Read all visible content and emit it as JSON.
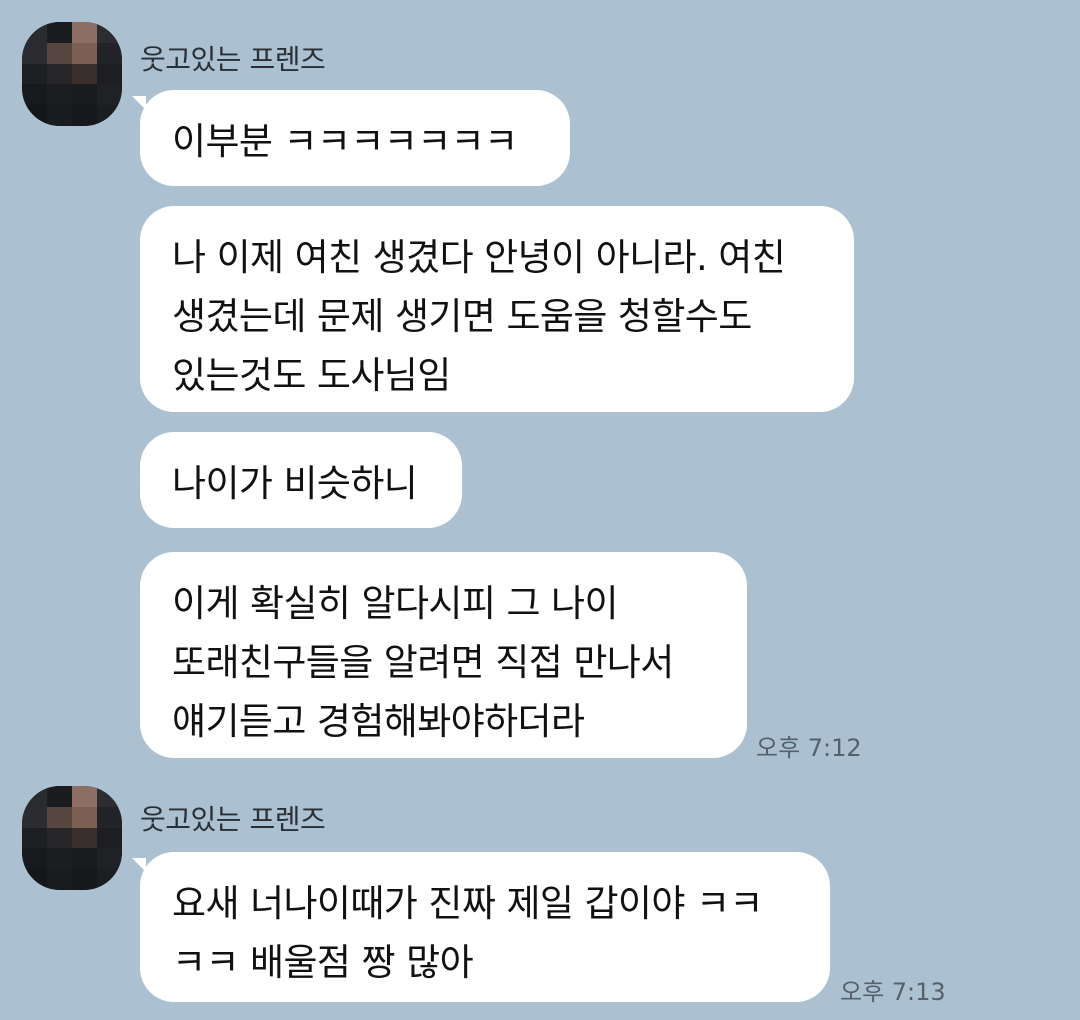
{
  "colors": {
    "chat_background": "#abc1d1",
    "bubble": "#ffffff",
    "text": "#111111"
  },
  "groups": [
    {
      "sender": "웃고있는 프렌즈",
      "avatar_icon": "pixelated-profile-photo",
      "messages": [
        {
          "text": "이부분 ㅋㅋㅋㅋㅋㅋㅋ"
        },
        {
          "text": "나 이제 여친 생겼다 안녕이 아니라. 여친\n생겼는데 문제 생기면 도움을 청할수도\n있는것도 도사님임"
        },
        {
          "text": "나이가 비슷하니"
        },
        {
          "text": "이게 확실히 알다시피 그 나이\n또래친구들을 알려면 직접 만나서\n얘기듣고 경험해봐야하더라",
          "time": "오후 7:12"
        }
      ]
    },
    {
      "sender": "웃고있는 프렌즈",
      "avatar_icon": "pixelated-profile-photo",
      "messages": [
        {
          "text": "요새 너나이때가 진짜 제일 갑이야 ㅋㅋ\nㅋㅋ 배울점 짱 많아",
          "time": "오후 7:13"
        }
      ]
    }
  ]
}
